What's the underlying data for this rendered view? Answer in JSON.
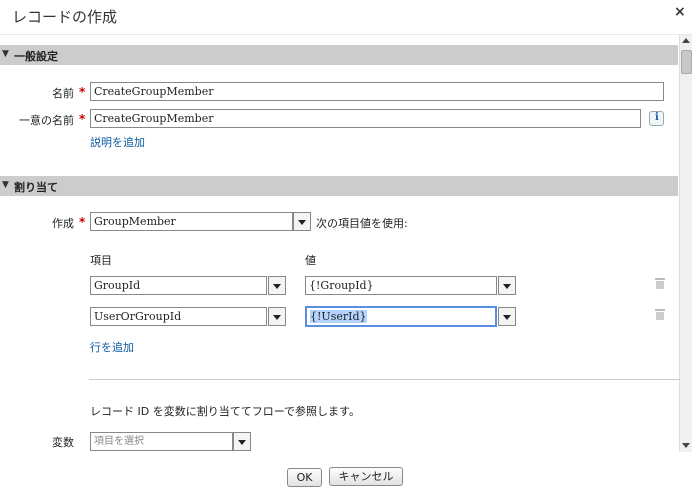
{
  "dialog": {
    "title": "レコードの作成",
    "close": "×"
  },
  "general_section": {
    "header": "一般設定",
    "name_label": "名前",
    "name_value": "CreateGroupMember",
    "unique_name_label": "一意の名前",
    "unique_name_value": "CreateGroupMember",
    "info_icon_text": "i",
    "add_description_link": "説明を追加"
  },
  "assignment_section": {
    "header": "割り当て",
    "create_label": "作成",
    "create_value": "GroupMember",
    "use_values_text": "次の項目値を使用:",
    "field_col_header": "項目",
    "value_col_header": "値",
    "rows": [
      {
        "field": "GroupId",
        "value": "{!GroupId}"
      },
      {
        "field": "UserOrGroupId",
        "value": "{!UserId}"
      }
    ],
    "add_row_link": "行を追加",
    "record_id_note": "レコード ID を変数に割り当ててフローで参照します。",
    "variable_label": "変数",
    "variable_placeholder": "項目を選択"
  },
  "required_marker": "*",
  "footer": {
    "ok_label": "OK",
    "cancel_label": "キャンセル"
  }
}
